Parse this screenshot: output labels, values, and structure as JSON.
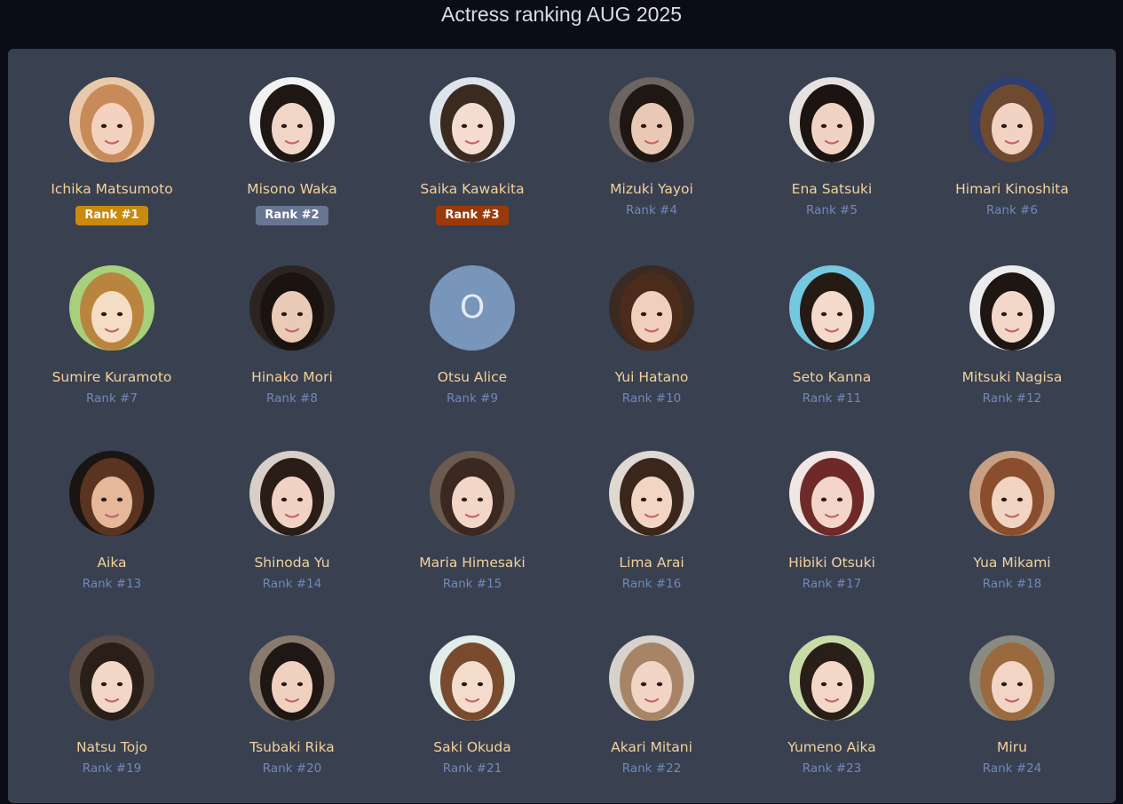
{
  "page": {
    "title": "Actress ranking AUG 2025"
  },
  "colors": {
    "gold": "#c98a0e",
    "silver": "#677792",
    "bronze": "#9a3a0a",
    "placeholder_bg": "#7895ba",
    "name_text": "#f1d29b",
    "rank_text": "#6f8ab8"
  },
  "actresses": [
    {
      "name": "Ichika Matsumoto",
      "rank": "Rank #1",
      "hair": "#c98a5a",
      "bg": "#e9c9a9",
      "skin": "#f3d2c0"
    },
    {
      "name": "Misono Waka",
      "rank": "Rank #2",
      "hair": "#1e1713",
      "bg": "#f2f2f2",
      "skin": "#f1d6c8"
    },
    {
      "name": "Saika Kawakita",
      "rank": "Rank #3",
      "hair": "#3a2a20",
      "bg": "#dfe3ea",
      "skin": "#f4ddd0"
    },
    {
      "name": "Mizuki Yayoi",
      "rank": "Rank #4",
      "hair": "#1f1712",
      "bg": "#6b6460",
      "skin": "#e9c9b6"
    },
    {
      "name": "Ena Satsuki",
      "rank": "Rank #5",
      "hair": "#1c1410",
      "bg": "#e6e2e0",
      "skin": "#f0d3c3"
    },
    {
      "name": "Himari Kinoshita",
      "rank": "Rank #6",
      "hair": "#6e4a30",
      "bg": "#2d3e72",
      "skin": "#f2d3c3"
    },
    {
      "name": "Sumire Kuramoto",
      "rank": "Rank #7",
      "hair": "#b9853e",
      "bg": "#a6d07a",
      "skin": "#f5dcc5"
    },
    {
      "name": "Hinako Mori",
      "rank": "Rank #8",
      "hair": "#1a1310",
      "bg": "#2b2421",
      "skin": "#eacbb8"
    },
    {
      "name": "Otsu Alice",
      "rank": "Rank #9",
      "initial": "O"
    },
    {
      "name": "Yui Hatano",
      "rank": "Rank #10",
      "hair": "#4a2b1c",
      "bg": "#3a2a22",
      "skin": "#f0d0bd"
    },
    {
      "name": "Seto Kanna",
      "rank": "Rank #11",
      "hair": "#261a14",
      "bg": "#74c8e0",
      "skin": "#f4dacb"
    },
    {
      "name": "Mitsuki Nagisa",
      "rank": "Rank #12",
      "hair": "#1d1613",
      "bg": "#ececec",
      "skin": "#f3d8ca"
    },
    {
      "name": "Aika",
      "rank": "Rank #13",
      "hair": "#5a3420",
      "bg": "#1a1412",
      "skin": "#e6b89a"
    },
    {
      "name": "Shinoda Yu",
      "rank": "Rank #14",
      "hair": "#2a1d17",
      "bg": "#d8cfc8",
      "skin": "#f0d3c3"
    },
    {
      "name": "Maria Himesaki",
      "rank": "Rank #15",
      "hair": "#3b2820",
      "bg": "#6a5a50",
      "skin": "#f2d6c8"
    },
    {
      "name": "Lima Arai",
      "rank": "Rank #16",
      "hair": "#3a261a",
      "bg": "#e0d8d2",
      "skin": "#f2d5c3"
    },
    {
      "name": "Hibiki Otsuki",
      "rank": "Rank #17",
      "hair": "#6e2a28",
      "bg": "#f0e6e4",
      "skin": "#f3d6c9"
    },
    {
      "name": "Yua Mikami",
      "rank": "Rank #18",
      "hair": "#8a4e2e",
      "bg": "#c79f82",
      "skin": "#f2d4c3"
    },
    {
      "name": "Natsu Tojo",
      "rank": "Rank #19",
      "hair": "#2a1e18",
      "bg": "#5a4c44",
      "skin": "#f2d6c8"
    },
    {
      "name": "Tsubaki Rika",
      "rank": "Rank #20",
      "hair": "#1f1714",
      "bg": "#8a7a6e",
      "skin": "#f0d1c0"
    },
    {
      "name": "Saki Okuda",
      "rank": "Rank #21",
      "hair": "#7a4a2e",
      "bg": "#e2ece8",
      "skin": "#f4dccc"
    },
    {
      "name": "Akari Mitani",
      "rank": "Rank #22",
      "hair": "#a88466",
      "bg": "#d8d2cc",
      "skin": "#f1d4c3"
    },
    {
      "name": "Yumeno Aika",
      "rank": "Rank #23",
      "hair": "#2a1e18",
      "bg": "#c8dca8",
      "skin": "#f3d8c8"
    },
    {
      "name": "Miru",
      "rank": "Rank #24",
      "hair": "#9a6a3e",
      "bg": "#8a8a80",
      "skin": "#f2d5c4"
    }
  ]
}
